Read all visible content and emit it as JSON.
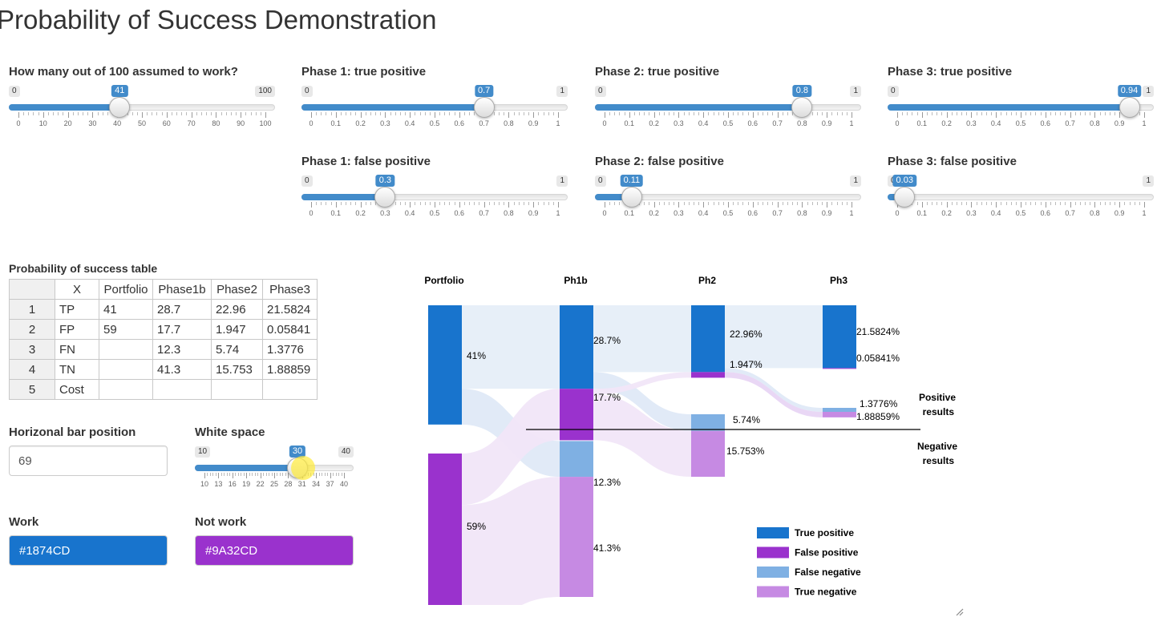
{
  "page_title": "Probability of Success Demonstration",
  "sliders": [
    {
      "id": "works",
      "label": "How many out of 100 assumed to work?",
      "min": 0,
      "max": 100,
      "value": 41,
      "ticks": [
        0,
        10,
        20,
        30,
        40,
        50,
        60,
        70,
        80,
        90,
        100
      ],
      "min_label": "0",
      "max_label": "100",
      "value_label": "41"
    },
    {
      "id": "p1tp",
      "label": "Phase 1: true positive",
      "min": 0,
      "max": 1,
      "value": 0.7,
      "ticks": [
        0,
        0.1,
        0.2,
        0.3,
        0.4,
        0.5,
        0.6,
        0.7,
        0.8,
        0.9,
        1
      ],
      "min_label": "0",
      "max_label": "1",
      "value_label": "0.7"
    },
    {
      "id": "p2tp",
      "label": "Phase 2: true positive",
      "min": 0,
      "max": 1,
      "value": 0.8,
      "ticks": [
        0,
        0.1,
        0.2,
        0.3,
        0.4,
        0.5,
        0.6,
        0.7,
        0.8,
        0.9,
        1
      ],
      "min_label": "0",
      "max_label": "1",
      "value_label": "0.8"
    },
    {
      "id": "p3tp",
      "label": "Phase 3: true positive",
      "min": 0,
      "max": 1,
      "value": 0.94,
      "ticks": [
        0,
        0.1,
        0.2,
        0.3,
        0.4,
        0.5,
        0.6,
        0.7,
        0.8,
        0.9,
        1
      ],
      "min_label": "0",
      "max_label": "1",
      "value_label": "0.94"
    },
    {
      "id": "p1fp",
      "label": "Phase 1: false positive",
      "min": 0,
      "max": 1,
      "value": 0.3,
      "ticks": [
        0,
        0.1,
        0.2,
        0.3,
        0.4,
        0.5,
        0.6,
        0.7,
        0.8,
        0.9,
        1
      ],
      "min_label": "0",
      "max_label": "1",
      "value_label": "0.3"
    },
    {
      "id": "p2fp",
      "label": "Phase 2: false positive",
      "min": 0,
      "max": 1,
      "value": 0.11,
      "ticks": [
        0,
        0.1,
        0.2,
        0.3,
        0.4,
        0.5,
        0.6,
        0.7,
        0.8,
        0.9,
        1
      ],
      "min_label": "0",
      "max_label": "1",
      "value_label": "0.11"
    },
    {
      "id": "p3fp",
      "label": "Phase 3: false positive",
      "min": 0,
      "max": 1,
      "value": 0.03,
      "ticks": [
        0,
        0.1,
        0.2,
        0.3,
        0.4,
        0.5,
        0.6,
        0.7,
        0.8,
        0.9,
        1
      ],
      "min_label": "0",
      "max_label": "1",
      "value_label": "0.03"
    },
    {
      "id": "whitespace",
      "label": "White space",
      "min": 10,
      "max": 40,
      "value": 30,
      "ticks": [
        10,
        13,
        16,
        19,
        22,
        25,
        28,
        31,
        34,
        37,
        40
      ],
      "min_label": "10",
      "max_label": "40",
      "value_label": "30"
    }
  ],
  "table": {
    "title": "Probability of success table",
    "headers": [
      "",
      "X",
      "Portfolio",
      "Phase1b",
      "Phase2",
      "Phase3"
    ],
    "rows": [
      [
        "1",
        "TP",
        "41",
        "28.7",
        "22.96",
        "21.5824"
      ],
      [
        "2",
        "FP",
        "59",
        "17.7",
        "1.947",
        "0.05841"
      ],
      [
        "3",
        "FN",
        "",
        "12.3",
        "5.74",
        "1.3776"
      ],
      [
        "4",
        "TN",
        "",
        "41.3",
        "15.753",
        "1.88859"
      ],
      [
        "5",
        "Cost",
        "",
        "",
        "",
        ""
      ]
    ]
  },
  "bar_position": {
    "label": "Horizonal bar position",
    "value": "69"
  },
  "work": {
    "label": "Work",
    "value": "#1874CD"
  },
  "not_work": {
    "label": "Not work",
    "value": "#9A32CD"
  },
  "colors": {
    "true_positive": "#1874CD",
    "false_positive": "#9A32CD",
    "false_negative": "#7FB0E3",
    "true_negative": "#C68AE3",
    "work_flow": "#E6EEF8",
    "notwork_flow": "#F1E6F8",
    "slider_accent": "#428BCA"
  },
  "chart_data": {
    "type": "sankey",
    "columns": [
      "Portfolio",
      "Ph1b",
      "Ph2",
      "Ph3"
    ],
    "nodes": [
      {
        "column": "Portfolio",
        "category": "Work",
        "value": 41,
        "label": "41%"
      },
      {
        "column": "Portfolio",
        "category": "Not work",
        "value": 59,
        "label": "59%"
      },
      {
        "column": "Ph1b",
        "category": "True positive",
        "value": 28.7,
        "label": "28.7%"
      },
      {
        "column": "Ph1b",
        "category": "False positive",
        "value": 17.7,
        "label": "17.7%"
      },
      {
        "column": "Ph1b",
        "category": "False negative",
        "value": 12.3,
        "label": "12.3%"
      },
      {
        "column": "Ph1b",
        "category": "True negative",
        "value": 41.3,
        "label": "41.3%"
      },
      {
        "column": "Ph2",
        "category": "True positive",
        "value": 22.96,
        "label": "22.96%"
      },
      {
        "column": "Ph2",
        "category": "False positive",
        "value": 1.947,
        "label": "1.947%"
      },
      {
        "column": "Ph2",
        "category": "False negative",
        "value": 5.74,
        "label": "5.74%"
      },
      {
        "column": "Ph2",
        "category": "True negative",
        "value": 15.753,
        "label": "15.753%"
      },
      {
        "column": "Ph3",
        "category": "True positive",
        "value": 21.5824,
        "label": "21.5824%"
      },
      {
        "column": "Ph3",
        "category": "False positive",
        "value": 0.05841,
        "label": "0.05841%"
      },
      {
        "column": "Ph3",
        "category": "False negative",
        "value": 1.3776,
        "label": "1.3776%"
      },
      {
        "column": "Ph3",
        "category": "True negative",
        "value": 1.88859,
        "label": "1.88859%"
      }
    ],
    "divider_labels": {
      "positive": [
        "Positive",
        "results"
      ],
      "negative": [
        "Negative",
        "results"
      ]
    },
    "legend": [
      "True positive",
      "False positive",
      "False negative",
      "True negative"
    ],
    "legend_position": "bottom-right"
  }
}
